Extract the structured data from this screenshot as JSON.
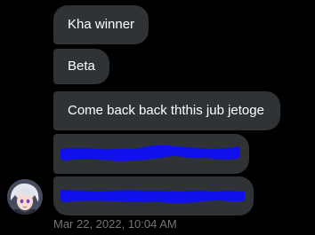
{
  "messages": [
    {
      "text": "Kha winner"
    },
    {
      "text": "Beta"
    },
    {
      "text": "Come back back ththis jub jetoge"
    },
    {
      "redacted": true
    },
    {
      "redacted": true
    }
  ],
  "timestamp": "Mar 22, 2022, 10:04 AM",
  "colors": {
    "background": "#000000",
    "bubble": "#2f3336",
    "text": "#ffffff",
    "timestamp": "#71767b",
    "redaction": "#1010ee"
  },
  "avatar": {
    "icon": "anime-avatar-icon"
  }
}
